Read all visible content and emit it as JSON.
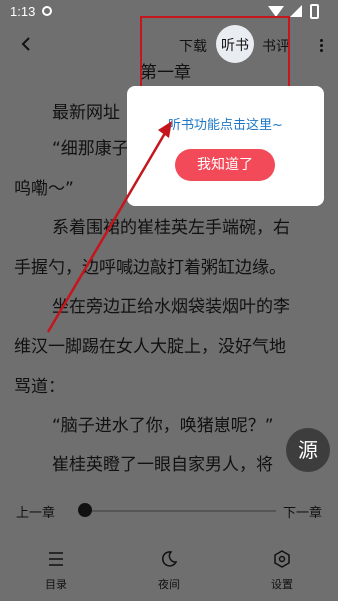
{
  "status_bar": {
    "time": "1:13"
  },
  "toolbar": {
    "download": "下载",
    "listen": "听书",
    "review": "书评"
  },
  "chapter_header_partial": "第一章",
  "content": {
    "lines": [
      "最新网址",
      "“细那康子",
      "呜嘞～”",
      "系着围裙的崔桂英左手端碗，右",
      "手握勺，边呼喊边敲打着粥缸边缘。",
      "坐在旁边正给水烟袋装烟叶的李",
      "维汉一脚踢在女人大腚上，没好气地",
      "骂道：",
      "“脑子进水了你，唤猪崽呢？”",
      "崔桂英瞪了一眼自家男人，将"
    ]
  },
  "popup": {
    "hint": "听书功能点击这里~",
    "confirm": "我知道了"
  },
  "source_button": "源",
  "chapter_nav": {
    "prev": "上一章",
    "next": "下一章",
    "progress": 0
  },
  "bottom_nav": {
    "items": [
      {
        "label": "目录",
        "icon": "list-icon"
      },
      {
        "label": "夜间",
        "icon": "moon-icon"
      },
      {
        "label": "设置",
        "icon": "settings-icon"
      }
    ]
  },
  "colors": {
    "overlay": "#6f6f6f",
    "accent_button": "#f24a58",
    "hint_text": "#1e78c8",
    "annotation_red": "#c4161c"
  }
}
